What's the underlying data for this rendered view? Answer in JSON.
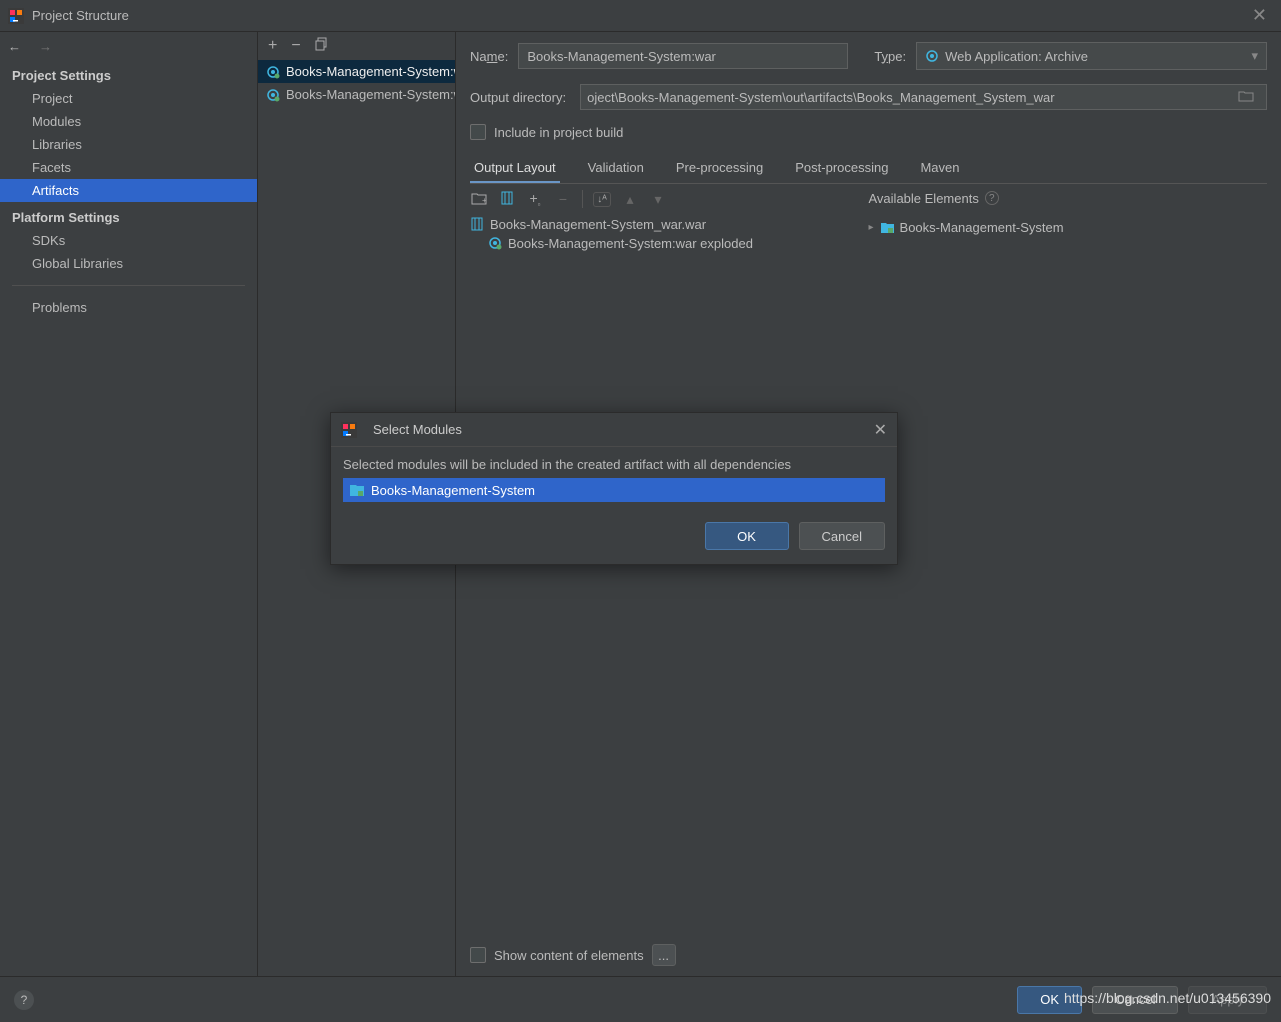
{
  "titlebar": {
    "title": "Project Structure"
  },
  "sidebar": {
    "heading1": "Project Settings",
    "items1": [
      "Project",
      "Modules",
      "Libraries",
      "Facets",
      "Artifacts"
    ],
    "selected1": 4,
    "heading2": "Platform Settings",
    "items2": [
      "SDKs",
      "Global Libraries"
    ],
    "heading3": "Problems"
  },
  "middle": {
    "items": [
      {
        "label": "Books-Management-System:war",
        "selected": true
      },
      {
        "label": "Books-Management-System:war exploded",
        "selected": false
      }
    ]
  },
  "form": {
    "name_label": "Name:",
    "name_value": "Books-Management-System:war",
    "type_label": "Type:",
    "type_value": "Web Application: Archive",
    "outdir_label": "Output directory:",
    "outdir_value": "oject\\Books-Management-System\\out\\artifacts\\Books_Management_System_war",
    "include_build": "Include in project build"
  },
  "tabs": [
    "Output Layout",
    "Validation",
    "Pre-processing",
    "Post-processing",
    "Maven"
  ],
  "layout": {
    "war_file": "Books-Management-System_war.war",
    "sub_item": "Books-Management-System:war exploded",
    "avail_header": "Available Elements",
    "avail_item": "Books-Management-System"
  },
  "bottom": {
    "show_content": "Show content of elements"
  },
  "footer": {
    "ok": "OK",
    "cancel": "Cancel",
    "apply": "Apply"
  },
  "modal": {
    "title": "Select Modules",
    "desc": "Selected modules will be included in the created artifact with all dependencies",
    "item": "Books-Management-System",
    "ok": "OK",
    "cancel": "Cancel"
  },
  "watermark": "https://blog.csdn.net/u013456390"
}
